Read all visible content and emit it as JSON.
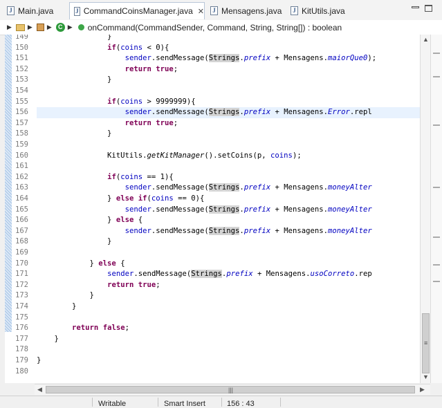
{
  "tabs": [
    {
      "label": "Main.java",
      "active": false
    },
    {
      "label": "CommandCoinsManager.java",
      "active": true
    },
    {
      "label": "Mensagens.java",
      "active": false
    },
    {
      "label": "KitUtils.java",
      "active": false
    }
  ],
  "tab_close_glyph": "✕",
  "breadcrumb": {
    "method": "onCommand(CommandSender, Command, String, String[]) : boolean",
    "class_icon_letter": "C",
    "icons": [
      "folder-icon",
      "package-icon",
      "class-icon",
      "method-icon"
    ]
  },
  "editor": {
    "line_numbers": [
      "149",
      "150",
      "151",
      "152",
      "153",
      "154",
      "155",
      "156",
      "157",
      "158",
      "159",
      "160",
      "161",
      "162",
      "163",
      "164",
      "165",
      "166",
      "167",
      "168",
      "169",
      "170",
      "171",
      "172",
      "173",
      "174",
      "175",
      "176",
      "177",
      "178",
      "179",
      "180"
    ],
    "code_lines": [
      {
        "n": "149",
        "text": "                }"
      },
      {
        "n": "150",
        "text": "                if(coins < 0){"
      },
      {
        "n": "151",
        "text": "                    sender.sendMessage(Strings.prefix + Mensagens.maiorQue0);"
      },
      {
        "n": "152",
        "text": "                    return true;"
      },
      {
        "n": "153",
        "text": "                }"
      },
      {
        "n": "154",
        "text": ""
      },
      {
        "n": "155",
        "text": "                if(coins > 9999999){"
      },
      {
        "n": "156",
        "text": "                    sender.sendMessage(Strings.prefix + Mensagens.Error.repl"
      },
      {
        "n": "157",
        "text": "                    return true;"
      },
      {
        "n": "158",
        "text": "                }"
      },
      {
        "n": "159",
        "text": ""
      },
      {
        "n": "160",
        "text": "                KitUtils.getKitManager().setCoins(p, coins);"
      },
      {
        "n": "161",
        "text": ""
      },
      {
        "n": "162",
        "text": "                if(coins == 1){"
      },
      {
        "n": "163",
        "text": "                    sender.sendMessage(Strings.prefix + Mensagens.moneyAlter"
      },
      {
        "n": "164",
        "text": "                } else if(coins == 0){"
      },
      {
        "n": "165",
        "text": "                    sender.sendMessage(Strings.prefix + Mensagens.moneyAlter"
      },
      {
        "n": "166",
        "text": "                } else {"
      },
      {
        "n": "167",
        "text": "                    sender.sendMessage(Strings.prefix + Mensagens.moneyAlter"
      },
      {
        "n": "168",
        "text": "                }"
      },
      {
        "n": "169",
        "text": ""
      },
      {
        "n": "170",
        "text": "            } else {"
      },
      {
        "n": "171",
        "text": "                sender.sendMessage(Strings.prefix + Mensagens.usoCorreto.rep"
      },
      {
        "n": "172",
        "text": "                return true;"
      },
      {
        "n": "173",
        "text": "            }"
      },
      {
        "n": "174",
        "text": "        }"
      },
      {
        "n": "175",
        "text": ""
      },
      {
        "n": "176",
        "text": "        return false;"
      },
      {
        "n": "177",
        "text": "    }"
      },
      {
        "n": "178",
        "text": ""
      },
      {
        "n": "179",
        "text": "}"
      },
      {
        "n": "180",
        "text": ""
      }
    ],
    "current_line": "156",
    "highlighted_line_number": "180"
  },
  "status": {
    "writable": "Writable",
    "insert_mode": "Smart Insert",
    "cursor_position": "156 : 43"
  },
  "colors": {
    "keyword": "#7f0055",
    "static_field": "#0000c0",
    "current_line_bg": "#e8f2fe",
    "occurrence_highlight": "#d4d4d4",
    "callout_box": "#e00000"
  }
}
